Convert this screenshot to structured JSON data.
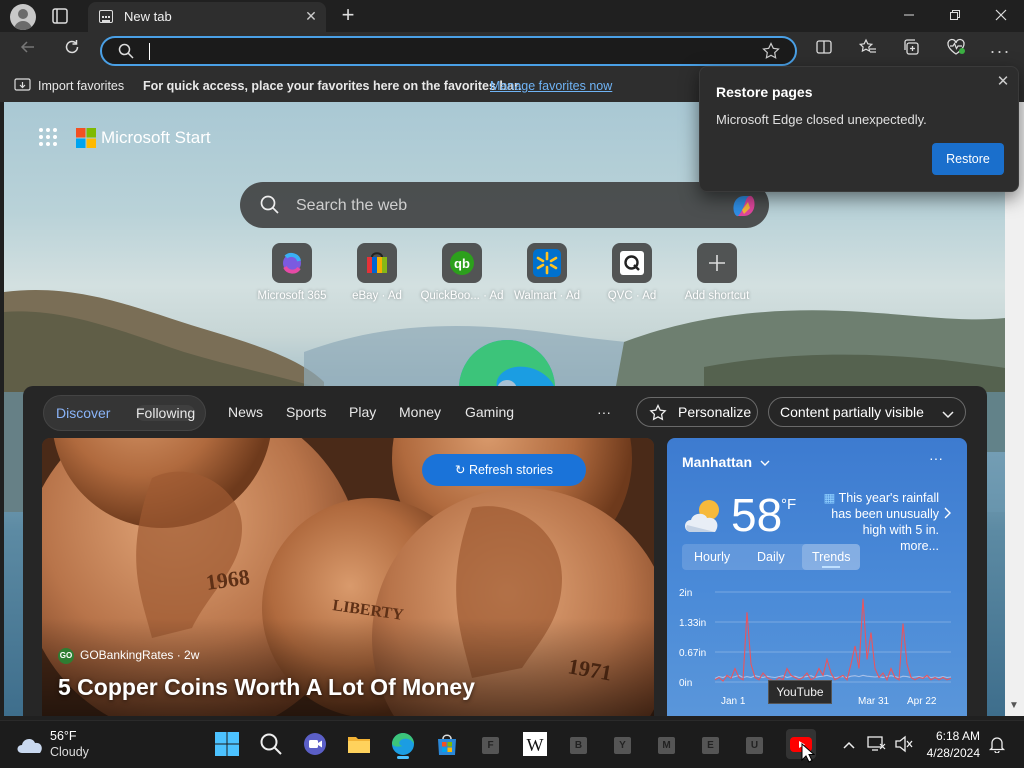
{
  "browser": {
    "tab_title": "New tab",
    "address_value": "",
    "favorites_bar": {
      "import_label": "Import favorites",
      "hint": "For quick access, place your favorites here on the favorites bar.",
      "manage_link": "Manage favorites now"
    }
  },
  "restore_popup": {
    "title": "Restore pages",
    "message": "Microsoft Edge closed unexpectedly.",
    "button": "Restore"
  },
  "ms_start": {
    "title": "Microsoft Start",
    "search_placeholder": "Search the web",
    "tiles": [
      {
        "label": "Microsoft 365",
        "icon": "microsoft-365-icon"
      },
      {
        "label": "eBay · Ad",
        "icon": "ebay-icon"
      },
      {
        "label": "QuickBoo... · Ad",
        "icon": "quickbooks-icon"
      },
      {
        "label": "Walmart · Ad",
        "icon": "walmart-icon"
      },
      {
        "label": "QVC · Ad",
        "icon": "qvc-icon"
      },
      {
        "label": "Add shortcut",
        "icon": "plus-icon"
      }
    ]
  },
  "feed": {
    "tabs": [
      "Discover",
      "Following"
    ],
    "nav": [
      "News",
      "Sports",
      "Play",
      "Money",
      "Gaming"
    ],
    "more": "···",
    "personalize": "Personalize",
    "content_visibility": "Content partially visible",
    "refresh_label": "Refresh stories",
    "hero": {
      "source": "GOBankingRates · 2w",
      "headline": "5 Copper Coins Worth A Lot Of Money"
    }
  },
  "weather": {
    "location": "Manhattan",
    "temp": "58",
    "unit": "°F",
    "alert": "This year's rainfall has been unusually high with 5 in. more...",
    "tabs": [
      "Hourly",
      "Daily",
      "Trends"
    ],
    "active_tab": "Trends",
    "chart_data": {
      "type": "line",
      "y_tick_labels": [
        "2in",
        "1.33in",
        "0.67in",
        "0in"
      ],
      "x_tick_labels": [
        "Jan 1",
        "Feb",
        "Mar 31",
        "Apr 22"
      ],
      "ylim": [
        0,
        2
      ],
      "series": [
        {
          "values": [
            0.05,
            0.1,
            0.02,
            0.15,
            0.08,
            0.3,
            0.1,
            0.05,
            1.55,
            0.4,
            0.1,
            0.05,
            0.2,
            0.1,
            0.05,
            0.02,
            0.1,
            0.05,
            0.3,
            0.15,
            0.1,
            0.05,
            0.1,
            0.2,
            0.05,
            0.1,
            0.3,
            0.15,
            0.5,
            0.2,
            0.05,
            0.1,
            0.15,
            0.05,
            0.4,
            0.8,
            0.3,
            1.85,
            0.5,
            1.1,
            0.3,
            0.1,
            0.2,
            0.05,
            0.3,
            0.1,
            0.05,
            1.3,
            0.4,
            0.1,
            0.05,
            0.1,
            0.08,
            0.15,
            0.05,
            0.1,
            0.05,
            0.1,
            0.05,
            0.08
          ]
        },
        {
          "values": [
            0.08,
            0.12,
            0.1,
            0.14,
            0.1,
            0.12,
            0.15,
            0.1,
            0.12,
            0.1,
            0.14,
            0.12,
            0.1,
            0.13,
            0.11,
            0.1,
            0.12,
            0.14,
            0.1,
            0.12,
            0.13,
            0.1,
            0.11,
            0.12,
            0.14,
            0.1,
            0.12,
            0.13,
            0.15,
            0.12,
            0.1,
            0.11,
            0.12,
            0.1,
            0.13,
            0.14,
            0.12,
            0.15,
            0.13,
            0.12,
            0.11,
            0.12,
            0.1,
            0.12,
            0.14,
            0.12,
            0.1,
            0.13,
            0.12,
            0.1,
            0.11,
            0.12,
            0.1,
            0.12,
            0.1,
            0.11,
            0.1,
            0.12,
            0.1,
            0.11
          ]
        }
      ]
    }
  },
  "taskbar": {
    "weather_temp": "56°F",
    "weather_desc": "Cloudy",
    "letters": [
      "F",
      "B",
      "Y",
      "M",
      "E",
      "U"
    ],
    "time": "6:18 AM",
    "date": "4/28/2024",
    "tooltip": "YouTube"
  },
  "colors": {
    "accent": "#1a73d9",
    "address_focus": "#4aa0e6",
    "feed_bg": "#262626",
    "chart_primary": "#e8555f",
    "chart_secondary": "#a8c0e8"
  }
}
